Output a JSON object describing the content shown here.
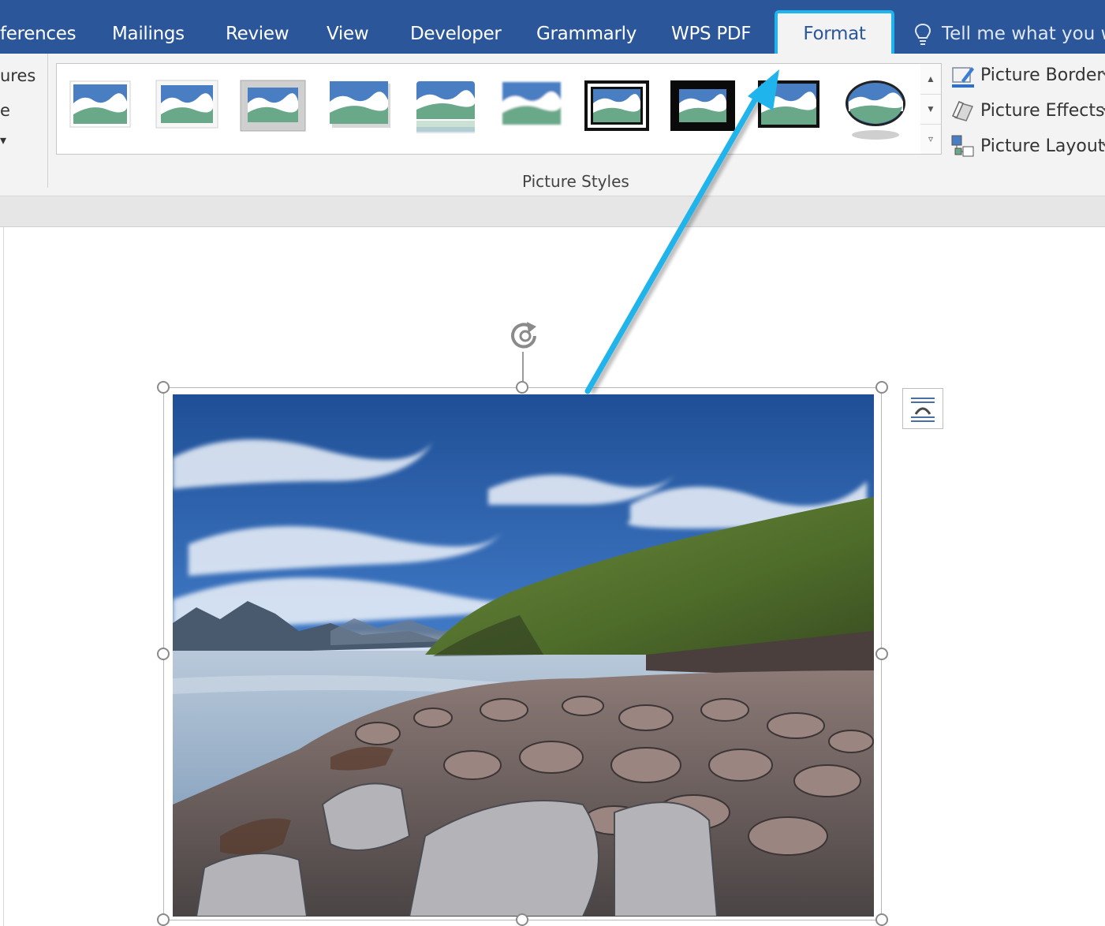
{
  "tabs": [
    {
      "label": "ferences",
      "active": false
    },
    {
      "label": "Mailings",
      "active": false
    },
    {
      "label": "Review",
      "active": false
    },
    {
      "label": "View",
      "active": false
    },
    {
      "label": "Developer",
      "active": false
    },
    {
      "label": "Grammarly",
      "active": false
    },
    {
      "label": "WPS PDF",
      "active": false
    },
    {
      "label": "Format",
      "active": true
    }
  ],
  "tell_me": {
    "text": "Tell me what you wa",
    "icon": "lightbulb-icon"
  },
  "left_group": {
    "line1": "ures",
    "line2": "e"
  },
  "picture_styles": {
    "group_label": "Picture Styles",
    "styles": [
      "simple-frame-white",
      "beveled-matte-white",
      "metal-frame",
      "drop-shadow-rectangle",
      "reflected-rounded-rectangle",
      "soft-edge-rectangle",
      "double-frame-black",
      "thick-matte-black",
      "simple-frame-black",
      "metal-oval"
    ]
  },
  "commands": {
    "border": {
      "label": "Picture Border",
      "icon": "picture-border-icon"
    },
    "effects": {
      "label": "Picture Effects",
      "icon": "picture-effects-icon"
    },
    "layout": {
      "label": "Picture Layout",
      "icon": "picture-layout-icon"
    }
  },
  "colors": {
    "tab_bar": "#2b579a",
    "ribbon": "#f3f3f3",
    "highlight": "#1fb4ec"
  },
  "document": {
    "image_subject": "rocky coastline with mountains and blue sky",
    "layout_options_icon": "layout-options-icon"
  }
}
